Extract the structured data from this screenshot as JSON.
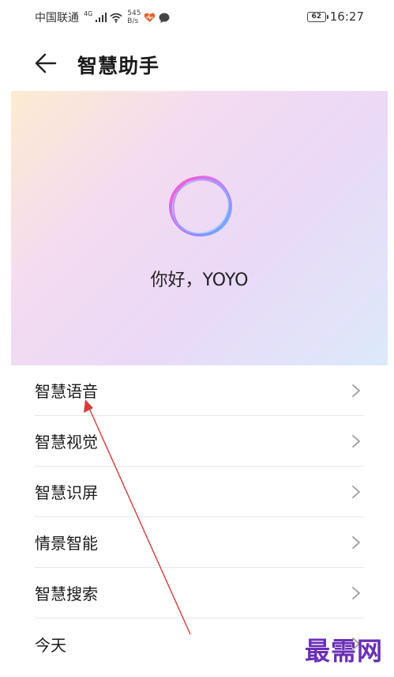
{
  "status_bar": {
    "carrier": "中国联通",
    "network_type": "4G",
    "speed_value": "545",
    "speed_unit": "B/s",
    "battery": "62",
    "time": "16:27"
  },
  "header": {
    "title": "智慧助手",
    "back_icon": "arrow-left-icon"
  },
  "hero": {
    "greeting": "你好，YOYO",
    "logo_icon": "assistant-ring-icon"
  },
  "menu": {
    "items": [
      {
        "label": "智慧语音"
      },
      {
        "label": "智慧视觉"
      },
      {
        "label": "智慧识屏"
      },
      {
        "label": "情景智能"
      },
      {
        "label": "智慧搜索"
      },
      {
        "label": "今天"
      }
    ],
    "chevron_icon": "chevron-right-icon"
  },
  "watermark": "最需网",
  "colors": {
    "annotation_arrow": "#d93a3a",
    "watermark": "#6a2fb5",
    "divider": "#e6e6e6"
  }
}
